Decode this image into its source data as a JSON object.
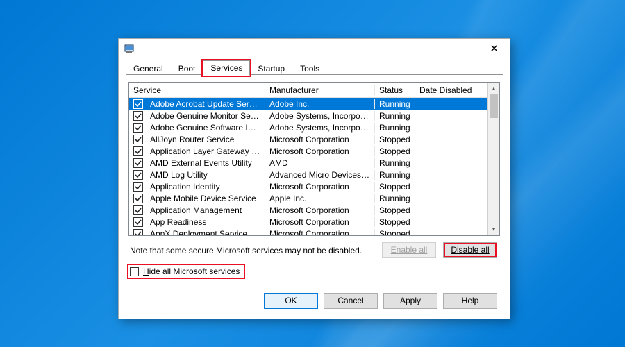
{
  "tabs": {
    "general": "General",
    "boot": "Boot",
    "services": "Services",
    "startup": "Startup",
    "tools": "Tools"
  },
  "columns": {
    "service": "Service",
    "manufacturer": "Manufacturer",
    "status": "Status",
    "date_disabled": "Date Disabled"
  },
  "rows": [
    {
      "svc": "Adobe Acrobat Update Service",
      "mfg": "Adobe Inc.",
      "sta": "Running",
      "dd": "",
      "checked": true,
      "selected": true
    },
    {
      "svc": "Adobe Genuine Monitor Service",
      "mfg": "Adobe Systems, Incorpora...",
      "sta": "Running",
      "dd": "",
      "checked": true
    },
    {
      "svc": "Adobe Genuine Software Integri...",
      "mfg": "Adobe Systems, Incorpora...",
      "sta": "Running",
      "dd": "",
      "checked": true
    },
    {
      "svc": "AllJoyn Router Service",
      "mfg": "Microsoft Corporation",
      "sta": "Stopped",
      "dd": "",
      "checked": true
    },
    {
      "svc": "Application Layer Gateway Service",
      "mfg": "Microsoft Corporation",
      "sta": "Stopped",
      "dd": "",
      "checked": true
    },
    {
      "svc": "AMD External Events Utility",
      "mfg": "AMD",
      "sta": "Running",
      "dd": "",
      "checked": true
    },
    {
      "svc": "AMD Log Utility",
      "mfg": "Advanced Micro Devices, I...",
      "sta": "Running",
      "dd": "",
      "checked": true
    },
    {
      "svc": "Application Identity",
      "mfg": "Microsoft Corporation",
      "sta": "Stopped",
      "dd": "",
      "checked": true
    },
    {
      "svc": "Apple Mobile Device Service",
      "mfg": "Apple Inc.",
      "sta": "Running",
      "dd": "",
      "checked": true
    },
    {
      "svc": "Application Management",
      "mfg": "Microsoft Corporation",
      "sta": "Stopped",
      "dd": "",
      "checked": true
    },
    {
      "svc": "App Readiness",
      "mfg": "Microsoft Corporation",
      "sta": "Stopped",
      "dd": "",
      "checked": true
    },
    {
      "svc": "AppX Deployment Service (AppX...",
      "mfg": "Microsoft Corporation",
      "sta": "Stopped",
      "dd": "",
      "checked": true
    }
  ],
  "note": "Note that some secure Microsoft services may not be disabled.",
  "buttons": {
    "enable_all": "Enable all",
    "disable_all": "Disable all",
    "ok": "OK",
    "cancel": "Cancel",
    "apply": "Apply",
    "help": "Help"
  },
  "hide_label": "Hide all Microsoft services"
}
